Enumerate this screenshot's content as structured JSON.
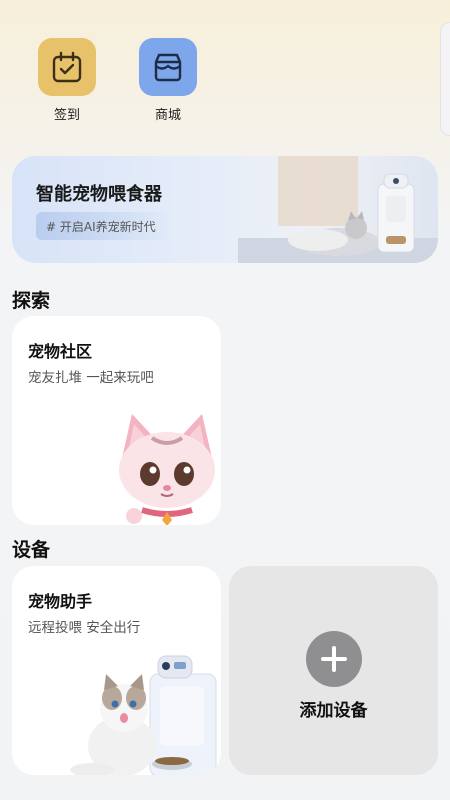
{
  "quick_actions": [
    {
      "label": "签到",
      "icon": "calendar-check-icon",
      "color": "#e8c26b"
    },
    {
      "label": "商城",
      "icon": "store-icon",
      "color": "#7ea6ea"
    }
  ],
  "banner": {
    "title": "智能宠物喂食器",
    "tag": "# 开启AI养宠新时代"
  },
  "explore": {
    "section_title": "探索",
    "community": {
      "title": "宠物社区",
      "subtitle": "宠友扎堆 一起来玩吧"
    }
  },
  "devices": {
    "section_title": "设备",
    "assistant": {
      "title": "宠物助手",
      "subtitle": "远程投喂 安全出行"
    },
    "add_device": {
      "label": "添加设备"
    }
  }
}
